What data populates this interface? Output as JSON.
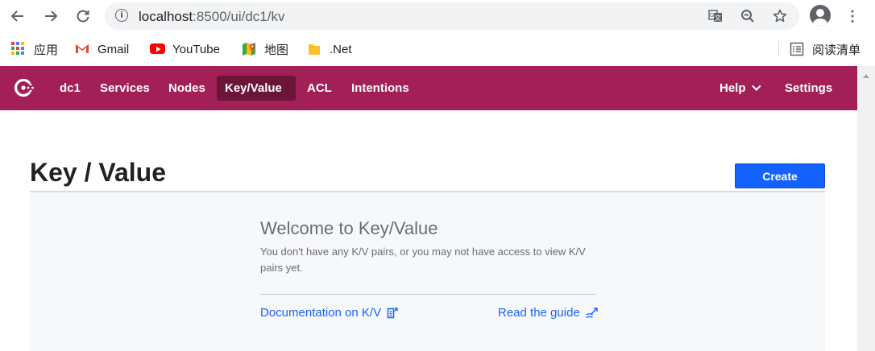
{
  "browser": {
    "url_host": "localhost",
    "url_path": ":8500/ui/dc1/kv"
  },
  "bookmarks": {
    "items": [
      {
        "label": "应用",
        "icon": "apps-grid-icon"
      },
      {
        "label": "Gmail",
        "icon": "gmail-icon"
      },
      {
        "label": "YouTube",
        "icon": "youtube-icon"
      },
      {
        "label": "地图",
        "icon": "maps-icon"
      },
      {
        "label": ".Net",
        "icon": "folder-icon"
      }
    ],
    "reading_list": "阅读清单"
  },
  "header": {
    "nav": [
      "dc1",
      "Services",
      "Nodes",
      "Key/Value",
      "ACL",
      "Intentions"
    ],
    "active": "Key/Value",
    "help": "Help",
    "settings": "Settings",
    "brand_color": "#a21f57"
  },
  "main": {
    "title": "Key / Value",
    "create_label": "Create",
    "empty": {
      "title": "Welcome to Key/Value",
      "text": "You don't have any K/V pairs, or you may not have access to view K/V pairs yet.",
      "doc_link": "Documentation on K/V",
      "guide_link": "Read the guide"
    }
  }
}
